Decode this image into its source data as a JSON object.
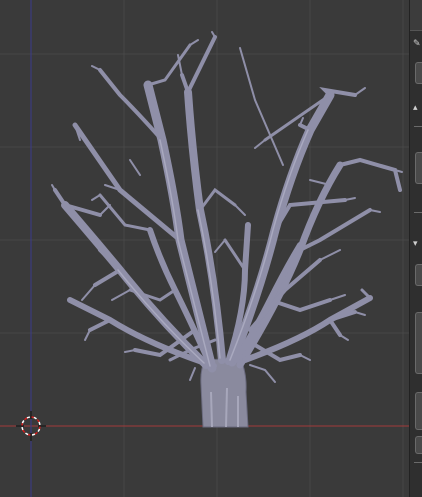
{
  "viewport": {
    "background": "#3a3a3a",
    "grid_color": "#474747",
    "x_axis_color": "#a13a3a",
    "y_axis_color": "#3a3a8c",
    "cursor_color": "#d21e1e",
    "object": "bare-tree-mesh",
    "mesh_color": "#8e8ea6"
  },
  "side_panel": {
    "background": "#2f2f2f",
    "icons": [
      "cursor-icon",
      "grease-pencil-icon",
      "expand-arrow-icon",
      "collapse-arrow-icon"
    ]
  }
}
